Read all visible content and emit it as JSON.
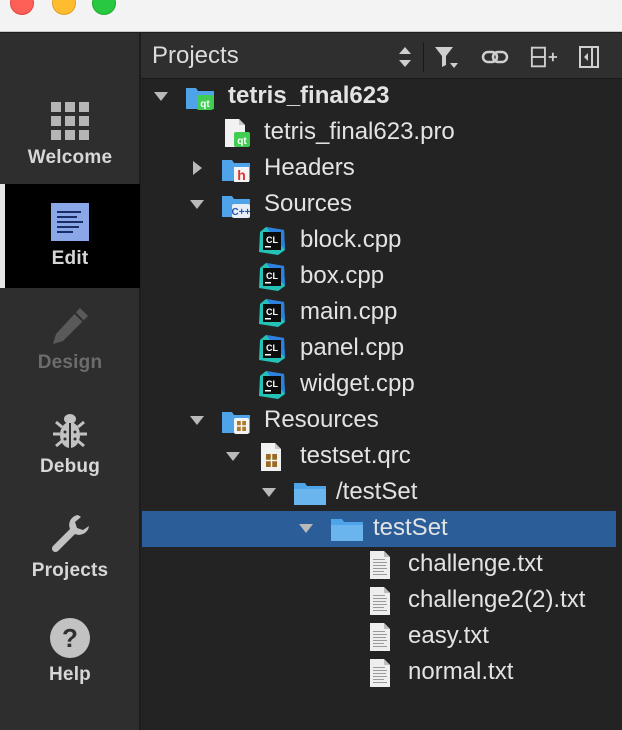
{
  "window": {
    "controls": [
      "close",
      "minimize",
      "zoom"
    ]
  },
  "modes": [
    {
      "label": "Welcome",
      "icon": "grid-icon",
      "active": false,
      "enabled": true
    },
    {
      "label": "Edit",
      "icon": "document-icon",
      "active": true,
      "enabled": true
    },
    {
      "label": "Design",
      "icon": "pencil-icon",
      "active": false,
      "enabled": false
    },
    {
      "label": "Debug",
      "icon": "bug-icon",
      "active": false,
      "enabled": true
    },
    {
      "label": "Projects",
      "icon": "wrench-icon",
      "active": false,
      "enabled": true
    },
    {
      "label": "Help",
      "icon": "help-icon",
      "active": false,
      "enabled": true
    }
  ],
  "pane": {
    "title": "Projects",
    "tools": [
      "sort-icon",
      "filter-icon",
      "link-icon",
      "split-icon",
      "close-pane-icon"
    ]
  },
  "tree": [
    {
      "label": "tetris_final623",
      "icon": "qt-project-icon",
      "depth": 0,
      "expander": "expanded",
      "bold": true
    },
    {
      "label": "tetris_final623.pro",
      "icon": "qt-file-icon",
      "depth": 1,
      "expander": "none"
    },
    {
      "label": "Headers",
      "icon": "headers-folder-icon",
      "depth": 1,
      "expander": "collapsed"
    },
    {
      "label": "Sources",
      "icon": "sources-folder-icon",
      "depth": 1,
      "expander": "expanded"
    },
    {
      "label": "block.cpp",
      "icon": "cpp-file-icon",
      "depth": 2,
      "expander": "none"
    },
    {
      "label": "box.cpp",
      "icon": "cpp-file-icon",
      "depth": 2,
      "expander": "none"
    },
    {
      "label": "main.cpp",
      "icon": "cpp-file-icon",
      "depth": 2,
      "expander": "none"
    },
    {
      "label": "panel.cpp",
      "icon": "cpp-file-icon",
      "depth": 2,
      "expander": "none"
    },
    {
      "label": "widget.cpp",
      "icon": "cpp-file-icon",
      "depth": 2,
      "expander": "none"
    },
    {
      "label": "Resources",
      "icon": "resources-folder-icon",
      "depth": 1,
      "expander": "expanded"
    },
    {
      "label": "testset.qrc",
      "icon": "qrc-file-icon",
      "depth": 2,
      "expander": "expanded"
    },
    {
      "label": "/testSet",
      "icon": "folder-icon",
      "depth": 3,
      "expander": "expanded"
    },
    {
      "label": "testSet",
      "icon": "folder-icon",
      "depth": 4,
      "expander": "expanded",
      "selected": true
    },
    {
      "label": "challenge.txt",
      "icon": "text-file-icon",
      "depth": 5,
      "expander": "none"
    },
    {
      "label": "challenge2(2).txt",
      "icon": "text-file-icon",
      "depth": 5,
      "expander": "none"
    },
    {
      "label": "easy.txt",
      "icon": "text-file-icon",
      "depth": 5,
      "expander": "none"
    },
    {
      "label": "normal.txt",
      "icon": "text-file-icon",
      "depth": 5,
      "expander": "none"
    }
  ],
  "colors": {
    "selection": "#2b5d99",
    "folder": "#4fa3e8",
    "cpp_icon": "#23c3b8",
    "qt_green": "#41cd52"
  }
}
